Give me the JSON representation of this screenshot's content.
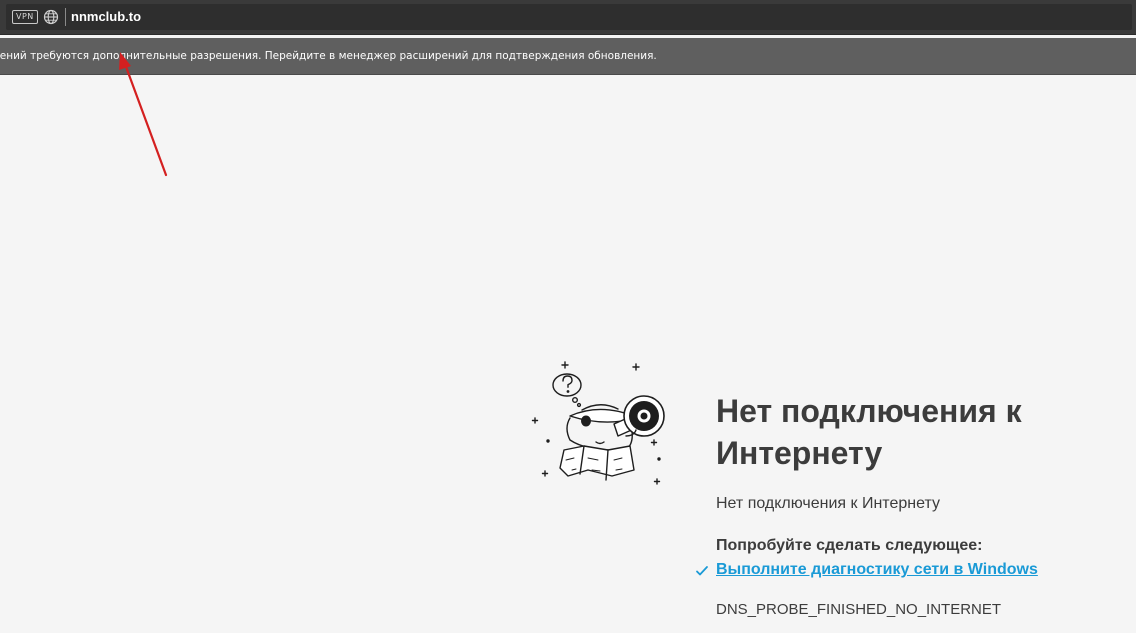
{
  "addressbar": {
    "vpn_label": "VPN",
    "url": "nnmclub.to"
  },
  "notification": {
    "text": "ения расширений требуются дополнительные разрешения. Перейдите в менеджер расширений для подтверждения обновления."
  },
  "error_page": {
    "title": "Нет подключения к Интернету",
    "subtitle": "Нет подключения к Интернету",
    "suggestions_heading": "Попробуйте сделать следующее:",
    "suggestions": [
      {
        "label": "Выполните диагностику сети в Windows"
      }
    ],
    "error_code": "DNS_PROBE_FINISHED_NO_INTERNET",
    "illustration_icon": "dino-with-spyglass-icon"
  },
  "colors": {
    "page_background": "#f5f5f5",
    "toolbar": "#3a3a3a",
    "notification_bar": "#5f5f5f",
    "link": "#1a9ad6",
    "text": "#3c3c3c",
    "annotation_arrow": "#d42020"
  }
}
